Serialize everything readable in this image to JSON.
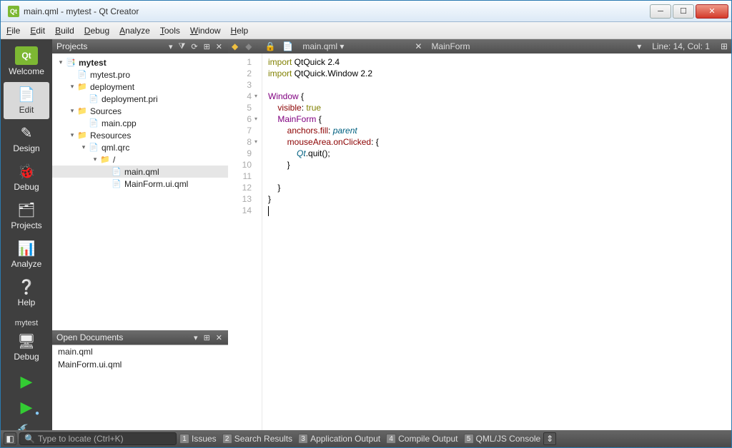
{
  "window": {
    "title": "main.qml - mytest - Qt Creator"
  },
  "menu": {
    "file": "File",
    "edit": "Edit",
    "build": "Build",
    "debug": "Debug",
    "analyze": "Analyze",
    "tools": "Tools",
    "window": "Window",
    "help": "Help"
  },
  "modes": {
    "welcome": "Welcome",
    "edit": "Edit",
    "design": "Design",
    "debug": "Debug",
    "projects": "Projects",
    "analyze": "Analyze",
    "help": "Help",
    "project_label": "mytest",
    "kit_label": "Debug"
  },
  "projects_panel": {
    "title": "Projects",
    "tree": [
      {
        "depth": 0,
        "arrow": "▾",
        "icon": "📑",
        "label": "mytest",
        "bold": true
      },
      {
        "depth": 1,
        "arrow": " ",
        "icon": "📄",
        "label": "mytest.pro"
      },
      {
        "depth": 1,
        "arrow": "▾",
        "icon": "📁",
        "label": "deployment"
      },
      {
        "depth": 2,
        "arrow": " ",
        "icon": "📄",
        "label": "deployment.pri"
      },
      {
        "depth": 1,
        "arrow": "▾",
        "icon": "📁",
        "label": "Sources"
      },
      {
        "depth": 2,
        "arrow": " ",
        "icon": "📄",
        "label": "main.cpp"
      },
      {
        "depth": 1,
        "arrow": "▾",
        "icon": "📁",
        "label": "Resources"
      },
      {
        "depth": 2,
        "arrow": "▾",
        "icon": "📄",
        "label": "qml.qrc"
      },
      {
        "depth": 3,
        "arrow": "▾",
        "icon": "📁",
        "label": "/"
      },
      {
        "depth": 4,
        "arrow": " ",
        "icon": "📄",
        "label": "main.qml",
        "selected": true
      },
      {
        "depth": 4,
        "arrow": " ",
        "icon": "📄",
        "label": "MainForm.ui.qml"
      }
    ]
  },
  "open_docs": {
    "title": "Open Documents",
    "items": [
      "main.qml",
      "MainForm.ui.qml"
    ]
  },
  "editor": {
    "file": "main.qml",
    "symbol": "MainForm",
    "pos": "Line: 14, Col: 1",
    "lines": [
      {
        "n": 1,
        "html": "<span class='kw'>import</span> QtQuick 2.4"
      },
      {
        "n": 2,
        "html": "<span class='kw'>import</span> QtQuick.Window 2.2"
      },
      {
        "n": 3,
        "html": ""
      },
      {
        "n": 4,
        "fold": "▾",
        "html": "<span class='type'>Window</span> {"
      },
      {
        "n": 5,
        "html": "    <span class='prop'>visible</span>: <span class='kw'>true</span>"
      },
      {
        "n": 6,
        "fold": "▾",
        "html": "    <span class='type'>MainForm</span> {"
      },
      {
        "n": 7,
        "html": "        <span class='prop'>anchors.fill</span>: <span class='ital'>parent</span>"
      },
      {
        "n": 8,
        "fold": "▾",
        "html": "        <span class='prop'>mouseArea.onClicked</span>: {"
      },
      {
        "n": 9,
        "html": "            <span class='ital'>Qt</span>.quit();"
      },
      {
        "n": 10,
        "html": "        }"
      },
      {
        "n": 11,
        "html": ""
      },
      {
        "n": 12,
        "html": "    }"
      },
      {
        "n": 13,
        "html": "}"
      },
      {
        "n": 14,
        "html": "<span class='cursor-line'></span>"
      }
    ]
  },
  "status": {
    "locate_placeholder": "Type to locate (Ctrl+K)",
    "panes": [
      {
        "n": "1",
        "label": "Issues"
      },
      {
        "n": "2",
        "label": "Search Results"
      },
      {
        "n": "3",
        "label": "Application Output"
      },
      {
        "n": "4",
        "label": "Compile Output"
      },
      {
        "n": "5",
        "label": "QML/JS Console"
      }
    ]
  }
}
